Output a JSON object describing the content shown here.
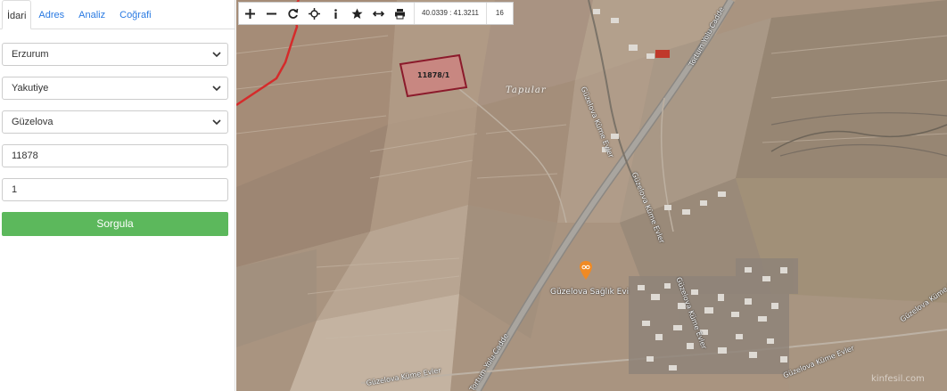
{
  "tabs": [
    {
      "label": "İdari",
      "active": true
    },
    {
      "label": "Adres"
    },
    {
      "label": "Analiz"
    },
    {
      "label": "Coğrafi"
    }
  ],
  "form": {
    "province": "Erzurum",
    "district": "Yakutiye",
    "neighborhood": "Güzelova",
    "block": "11878",
    "parcel": "1",
    "query_label": "Sorgula"
  },
  "toolbar": {
    "icons": [
      "zoom-in-icon",
      "zoom-out-icon",
      "refresh-icon",
      "locate-icon",
      "info-icon",
      "star-icon",
      "measure-icon",
      "print-icon"
    ],
    "coords": "40.0339 : 41.3211",
    "zoom": "16"
  },
  "map": {
    "parcel_label": "11878/1",
    "area_label": "Tapular",
    "poi_label": "Güzelova Sağlık Evi",
    "street_labels": [
      "Güzelova Küme Evler",
      "Güzelova Küme Evler",
      "Güzelova Küme Evler",
      "Güzelova Küme Evler",
      "Güzelova Küme Evler",
      "Güzelova Küme Evler",
      "Tortum Yolu Cadde",
      "Tortum Yolu Cadde"
    ],
    "watermark": "kinfesil.com",
    "colors": {
      "parcel_fill": "#d08080",
      "parcel_stroke": "#8b1a2b",
      "boundary": "#d52b2b",
      "poi": "#f08a24",
      "query_button": "#5cb85c"
    }
  }
}
